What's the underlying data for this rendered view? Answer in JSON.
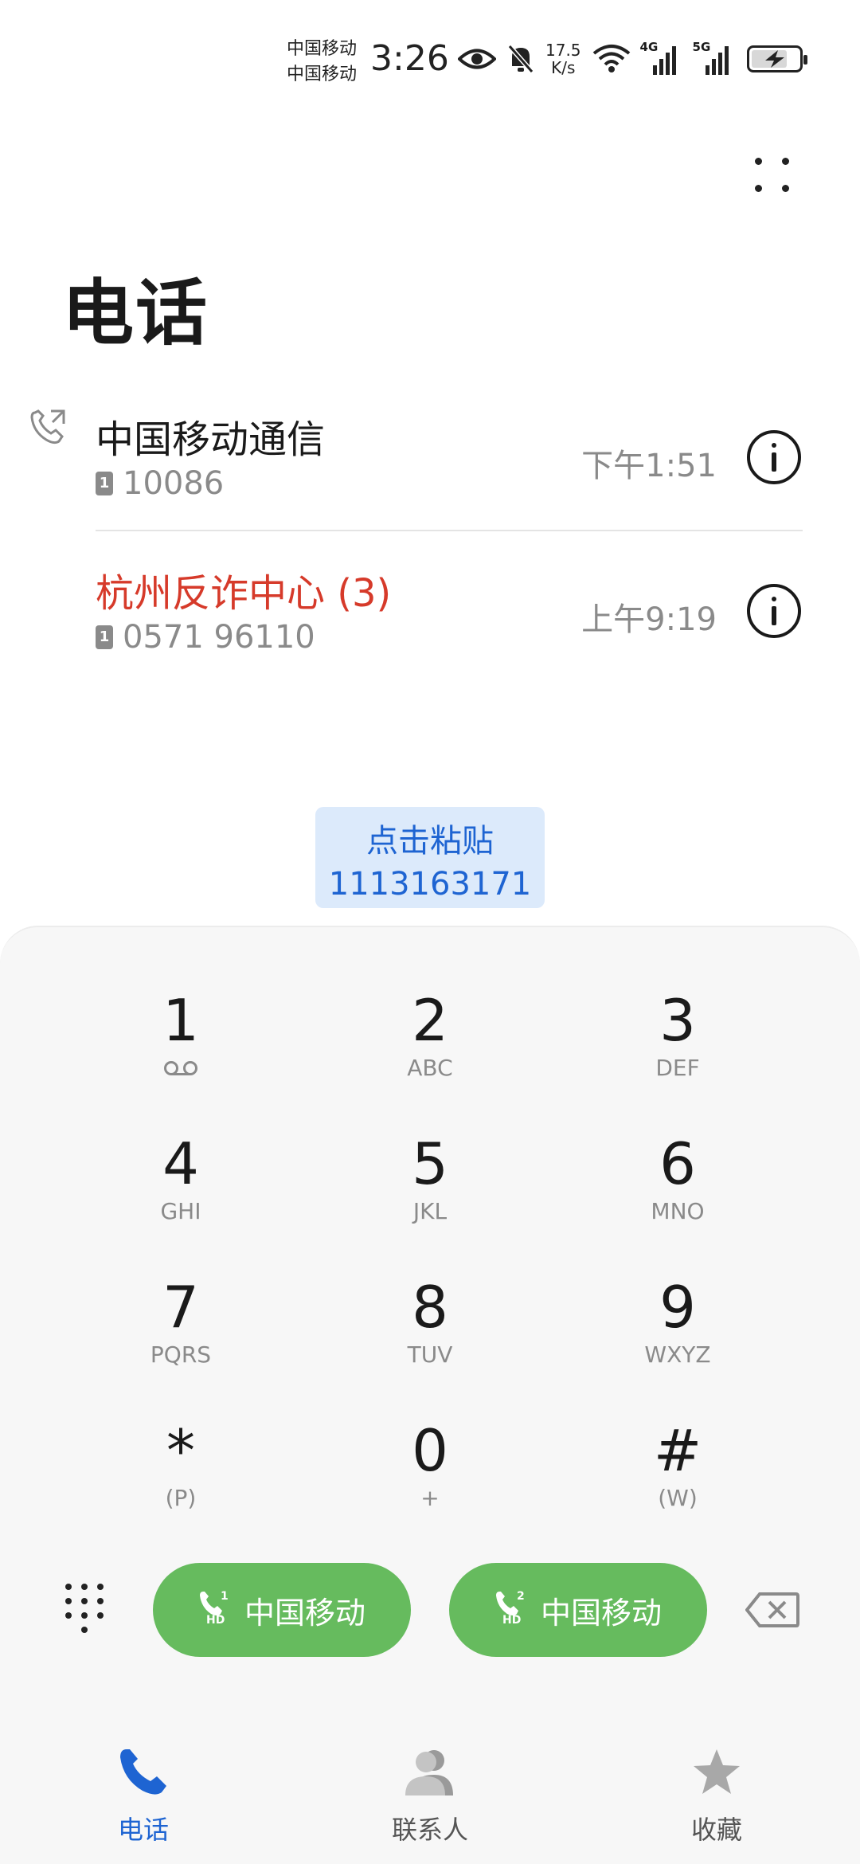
{
  "status_bar": {
    "carrier_1": "中国移动",
    "carrier_2": "中国移动",
    "time": "3:26",
    "speed_value": "17.5",
    "speed_unit": "K/s",
    "sim1_network": "4G",
    "sim2_network": "5G",
    "icons": [
      "eye-icon",
      "bell-off-icon",
      "wifi-icon",
      "signal-4g-icon",
      "signal-5g-icon",
      "battery-charging-icon"
    ]
  },
  "header": {
    "title": "电话"
  },
  "call_log": [
    {
      "name": "中国移动通信",
      "sim": "1",
      "number": "10086",
      "time": "下午1:51",
      "missed": false
    },
    {
      "name": "杭州反诈中心 (3)",
      "sim": "1",
      "number": "0571 96110",
      "time": "上午9:19",
      "missed": true
    }
  ],
  "paste_chip": {
    "label": "点击粘贴",
    "number": "1113163171"
  },
  "dialpad": {
    "keys": [
      {
        "digit": "1",
        "letters": ""
      },
      {
        "digit": "2",
        "letters": "ABC"
      },
      {
        "digit": "3",
        "letters": "DEF"
      },
      {
        "digit": "4",
        "letters": "GHI"
      },
      {
        "digit": "5",
        "letters": "JKL"
      },
      {
        "digit": "6",
        "letters": "MNO"
      },
      {
        "digit": "7",
        "letters": "PQRS"
      },
      {
        "digit": "8",
        "letters": "TUV"
      },
      {
        "digit": "9",
        "letters": "WXYZ"
      },
      {
        "digit": "*",
        "letters": "(P)"
      },
      {
        "digit": "0",
        "letters": "+"
      },
      {
        "digit": "#",
        "letters": "(W)"
      }
    ],
    "call_sim1_label": "中国移动",
    "call_sim1_index": "1",
    "call_sim2_label": "中国移动",
    "call_sim2_index": "2",
    "hd": "HD"
  },
  "bottom_nav": {
    "items": [
      {
        "label": "电话",
        "icon": "phone-icon",
        "active": true
      },
      {
        "label": "联系人",
        "icon": "contacts-icon",
        "active": false
      },
      {
        "label": "收藏",
        "icon": "star-icon",
        "active": false
      }
    ]
  },
  "colors": {
    "accent": "#1e64d2",
    "missed": "#d63a2a",
    "call_green": "#66bb5e",
    "paste_bg": "#dceafb"
  }
}
